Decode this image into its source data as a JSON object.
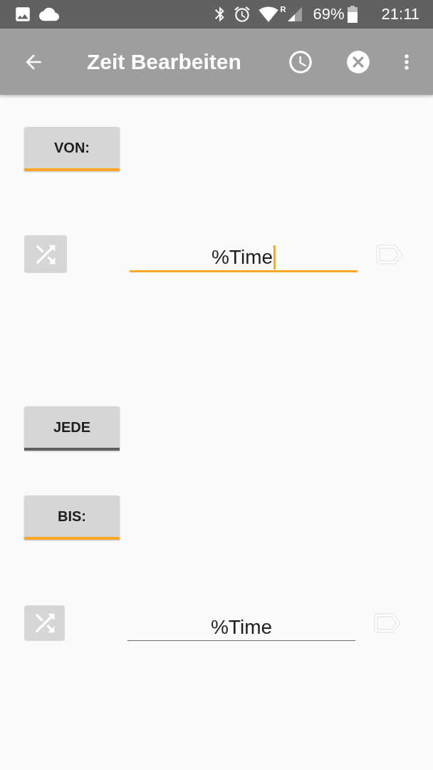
{
  "status_bar": {
    "roaming": "R",
    "battery": "69%",
    "time": "21:11"
  },
  "app_bar": {
    "title": "Zeit Bearbeiten"
  },
  "from": {
    "button": {
      "label": "VON:",
      "highlighted": true
    },
    "field": {
      "value": "%Time",
      "focused": true
    }
  },
  "every": {
    "button": {
      "label": "JEDE",
      "highlighted": false
    }
  },
  "to": {
    "button": {
      "label": "BIS:",
      "highlighted": true
    },
    "field": {
      "value": "%Time",
      "focused": false
    }
  }
}
